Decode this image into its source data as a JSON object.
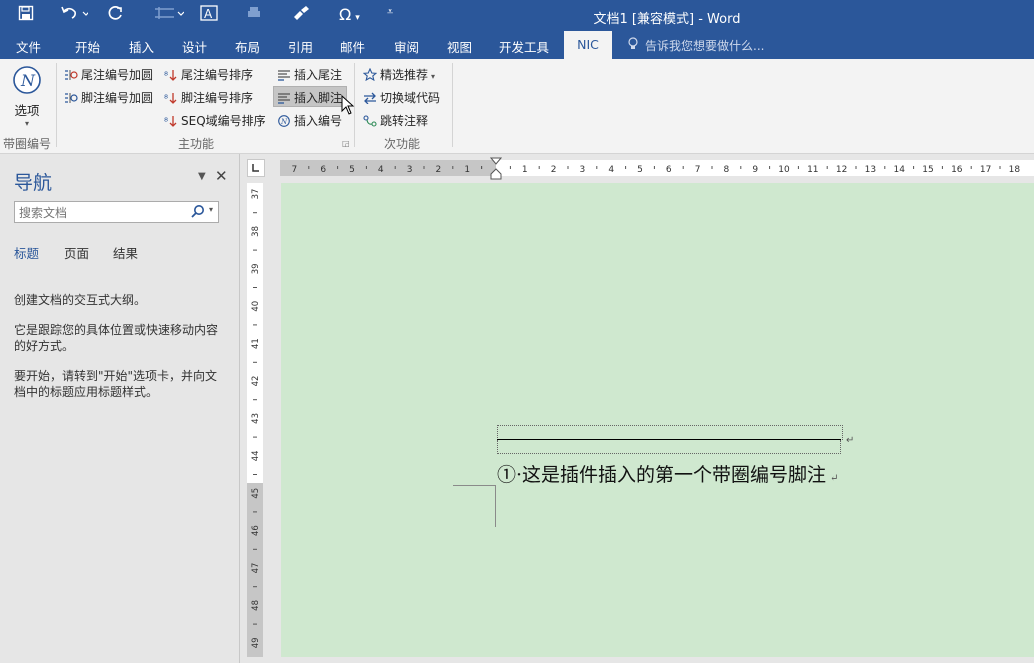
{
  "window": {
    "title": "文档1 [兼容模式] - Word"
  },
  "quick_access": {
    "more_label": "⌄"
  },
  "tabs": [
    "文件",
    "开始",
    "插入",
    "设计",
    "布局",
    "引用",
    "邮件",
    "审阅",
    "视图",
    "开发工具",
    "NIC"
  ],
  "tell_me": "告诉我您想要做什么...",
  "ribbon": {
    "options_label": "选项",
    "group1_label": "带圈编号",
    "group2_label": "主功能",
    "group3_label": "次功能",
    "btn_endnote_circle": "尾注编号加圆",
    "btn_footnote_circle": "脚注编号加圆",
    "btn_endnote_sort": "尾注编号排序",
    "btn_footnote_sort": "脚注编号排序",
    "btn_seq_sort": "SEQ域编号排序",
    "btn_insert_endnote": "插入尾注",
    "btn_insert_footnote": "插入脚注",
    "btn_insert_number": "插入编号",
    "btn_recommend": "精选推荐",
    "btn_toggle_field": "切换域代码",
    "btn_jump_note": "跳转注释"
  },
  "nav": {
    "title": "导航",
    "search_placeholder": "搜索文档",
    "tabs": [
      "标题",
      "页面",
      "结果"
    ],
    "text1": "创建文档的交互式大纲。",
    "text2": "它是跟踪您的具体位置或快速移动内容的好方式。",
    "text3": "要开始，请转到\"开始\"选项卡，并向文档中的标题应用标题样式。"
  },
  "ruler": {
    "h_left_numbers": [
      "7",
      "6",
      "5",
      "4",
      "3",
      "2",
      "1"
    ],
    "h_right_numbers": [
      "1",
      "2",
      "3",
      "4",
      "5",
      "6",
      "7",
      "8",
      "9",
      "10",
      "11",
      "12",
      "13",
      "14",
      "15",
      "16",
      "17",
      "18"
    ],
    "v_numbers": [
      "37",
      "38",
      "39",
      "40",
      "41",
      "42",
      "43",
      "44",
      "45",
      "46",
      "47",
      "48",
      "49"
    ]
  },
  "document": {
    "footnote_text": "①·这是插件插入的第一个带圈编号脚注",
    "para_mark": "↵"
  },
  "colors": {
    "accent": "#2b579a",
    "page_bg": "#cfe8cf"
  }
}
